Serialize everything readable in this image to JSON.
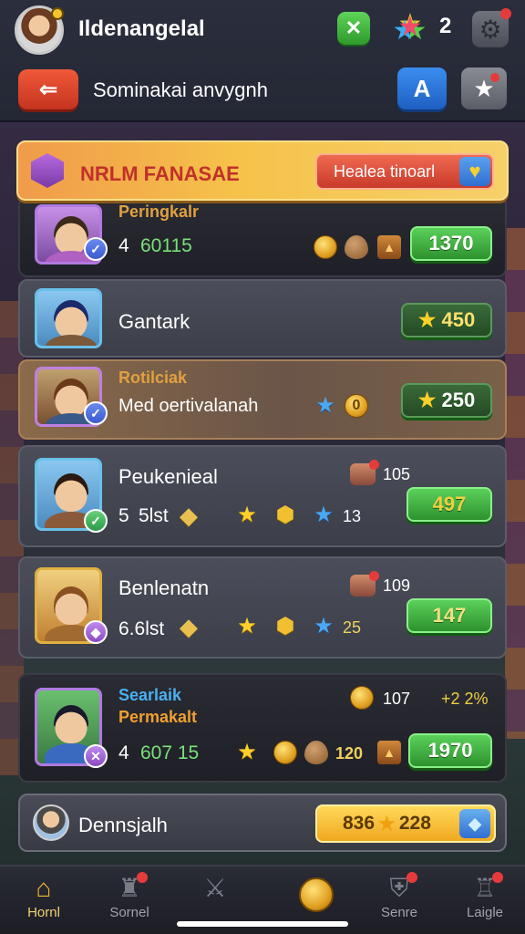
{
  "header": {
    "player_name": "Ildenangelal",
    "stars_count": "2",
    "search_label": "Sominakai anvygnh"
  },
  "banner": {
    "title": "NRLM FANASAE",
    "button_label": "Healea tinoarl"
  },
  "rows": [
    {
      "tag": "Peringkalr",
      "stat": "4",
      "stat_value": "60115",
      "score": "1370"
    },
    {
      "name": "Gantark",
      "score": "450"
    },
    {
      "tag": "Rotilciak",
      "name": "Med oertivalanah",
      "mid_value": "0",
      "score": "250"
    },
    {
      "name": "Peukenieal",
      "count": "105",
      "stat": "5",
      "stat_value": "5lst",
      "small_value": "13",
      "score": "497"
    },
    {
      "name": "Benlenatn",
      "count": "109",
      "stat": "6.6lst",
      "small_value": "25",
      "score": "147"
    },
    {
      "tag": "Searlaik",
      "name": "Permakalt",
      "count": "107",
      "percent": "+2 2%",
      "stat": "4",
      "stat_value": "607 15",
      "token_value": "120",
      "score": "1970"
    }
  ],
  "summary": {
    "name": "Dennsjalh",
    "value_left": "836",
    "value_right": "228"
  },
  "nav": [
    {
      "label": "Hornl"
    },
    {
      "label": "Sornel"
    },
    {
      "label": ""
    },
    {
      "label": ""
    },
    {
      "label": "Senre"
    },
    {
      "label": "Laigle"
    }
  ],
  "colors": {
    "accent_green": "#2e922e",
    "accent_gold": "#f4c430",
    "accent_red": "#c6331f",
    "accent_blue": "#1f5fc2"
  },
  "icons": {
    "close": "x-icon",
    "settings": "gear-icon",
    "back": "back-icon",
    "profile": "profile-icon",
    "favorite": "star-icon",
    "currency": "coin-icon"
  }
}
